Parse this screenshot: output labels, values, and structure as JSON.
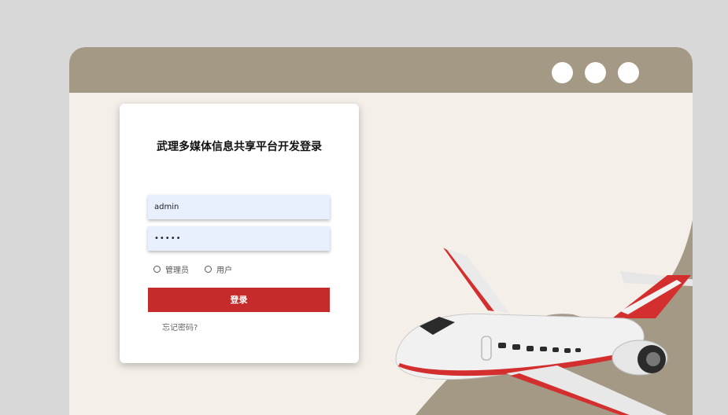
{
  "window": {
    "controls": [
      "circle-control",
      "circle-control",
      "circle-control"
    ]
  },
  "login": {
    "title": "武理多媒体信息共享平台开发登录",
    "username_value": "admin",
    "password_value": "•••••",
    "roles": [
      {
        "label": "管理员",
        "checked": false
      },
      {
        "label": "用户",
        "checked": false
      }
    ],
    "submit_label": "登录",
    "forgot_label": "忘记密码?"
  },
  "illustration": {
    "name": "airplane-illustration"
  },
  "colors": {
    "page_bg": "#d8d8d8",
    "window_bg": "#f4efe9",
    "titlebar": "#a39985",
    "accent": "#c62b2b",
    "input_bg": "#e8effd"
  }
}
